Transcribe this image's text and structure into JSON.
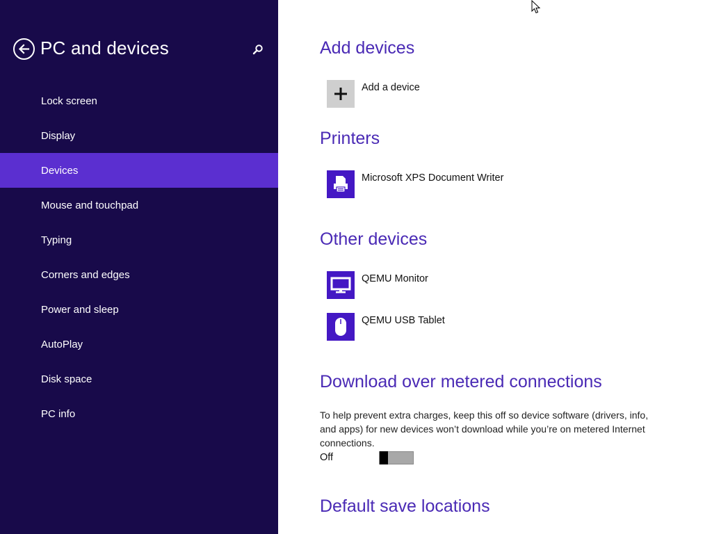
{
  "sidebar": {
    "title": "PC and devices",
    "back_icon": "back-arrow-icon",
    "search_icon": "search-icon",
    "items": [
      {
        "label": "Lock screen",
        "active": false
      },
      {
        "label": "Display",
        "active": false
      },
      {
        "label": "Devices",
        "active": true
      },
      {
        "label": "Mouse and touchpad",
        "active": false
      },
      {
        "label": "Typing",
        "active": false
      },
      {
        "label": "Corners and edges",
        "active": false
      },
      {
        "label": "Power and sleep",
        "active": false
      },
      {
        "label": "AutoPlay",
        "active": false
      },
      {
        "label": "Disk space",
        "active": false
      },
      {
        "label": "PC info",
        "active": false
      }
    ]
  },
  "main": {
    "add_devices": {
      "title": "Add devices",
      "add_label": "Add a device"
    },
    "printers": {
      "title": "Printers",
      "items": [
        {
          "label": "Microsoft XPS Document Writer",
          "icon": "printer-icon"
        }
      ]
    },
    "other_devices": {
      "title": "Other devices",
      "items": [
        {
          "label": "QEMU Monitor",
          "icon": "monitor-icon"
        },
        {
          "label": "QEMU USB Tablet",
          "icon": "mouse-icon"
        }
      ]
    },
    "metered": {
      "title": "Download over metered connections",
      "description": "To help prevent extra charges, keep this off so device software (drivers, info, and apps) for new devices won’t download while you’re on metered Internet connections.",
      "state_label": "Off"
    },
    "default_save": {
      "title": "Default save locations"
    }
  },
  "colors": {
    "sidebar_bg": "#180a4a",
    "sidebar_active": "#5b2fd0",
    "accent_text": "#4a2ab5",
    "tile": "#4418c4"
  }
}
